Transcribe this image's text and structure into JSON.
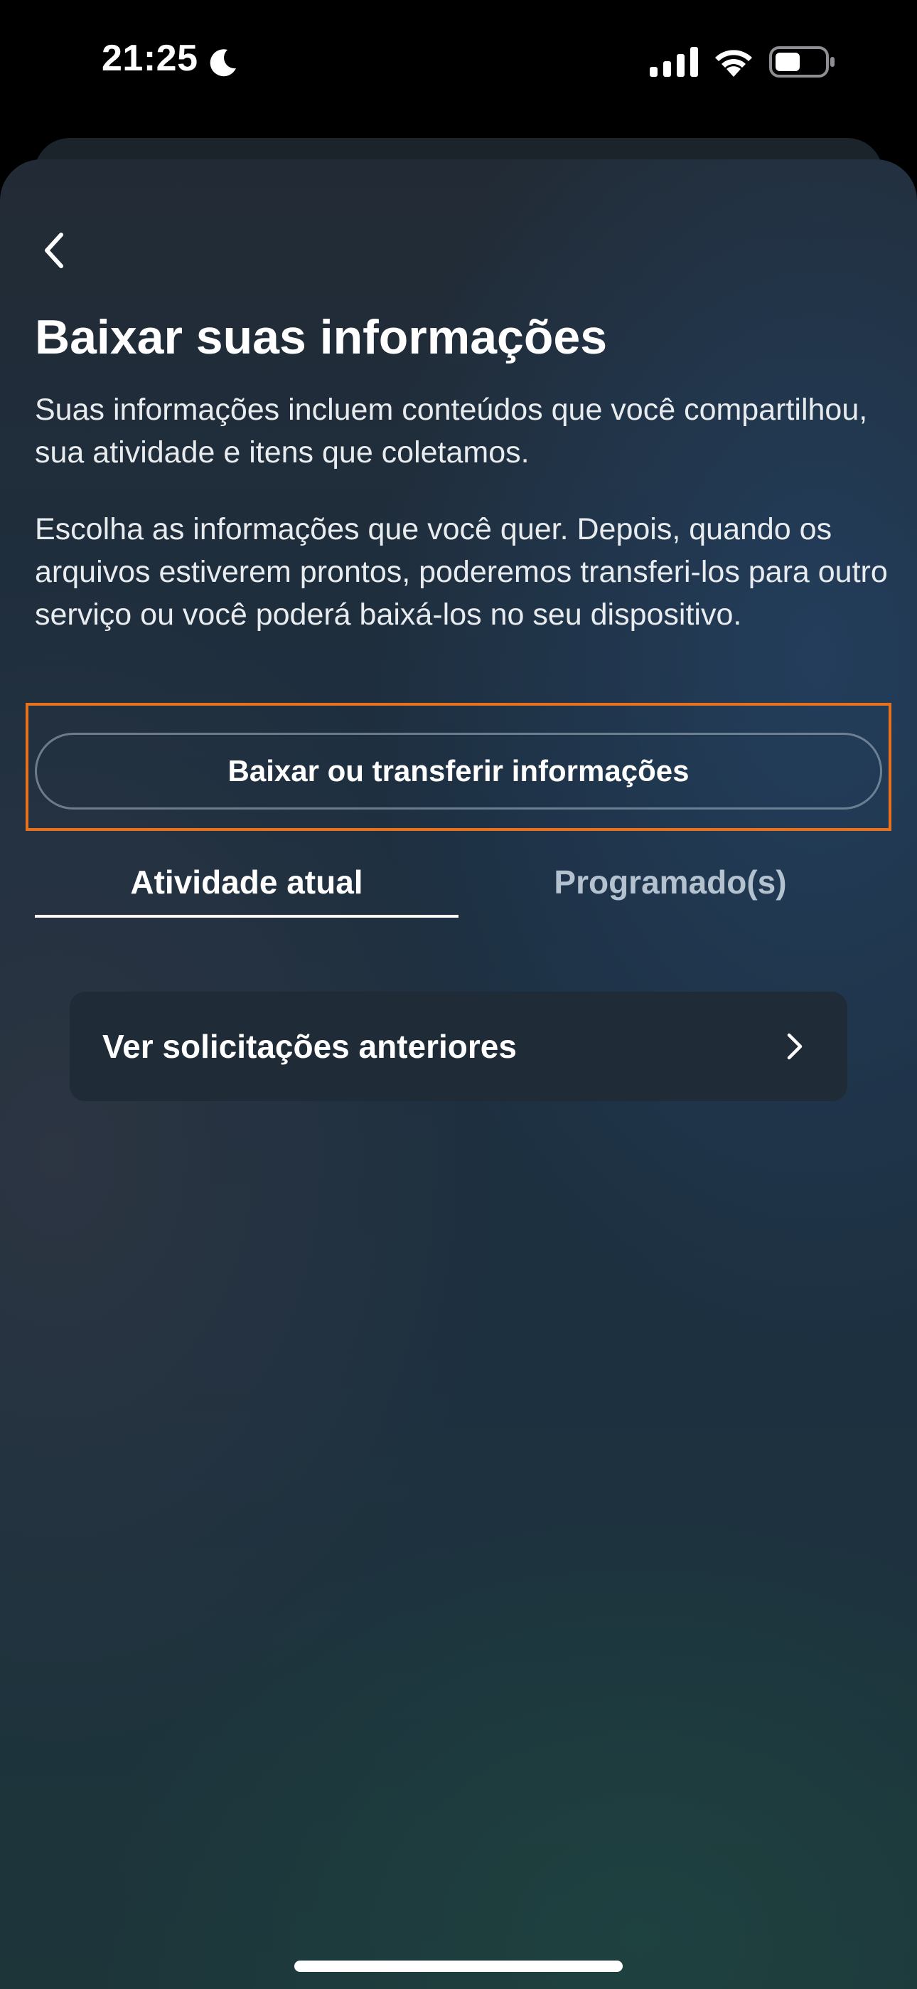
{
  "status_bar": {
    "time": "21:25",
    "icons": [
      "moon-icon",
      "signal-icon",
      "wifi-icon",
      "battery-icon"
    ]
  },
  "header": {
    "back_icon": "chevron-left-icon",
    "title": "Baixar suas informações"
  },
  "description": {
    "paragraph_1": "Suas informações incluem conteúdos que você compartilhou, sua atividade e itens que coletamos.",
    "paragraph_2": "Escolha as informações que você quer. Depois, quando os arquivos estiverem prontos, poderemos transferi-los para outro serviço ou você poderá baixá-los no seu dispositivo."
  },
  "primary_action": {
    "label": "Baixar ou transferir informações"
  },
  "tabs": [
    {
      "label": "Atividade atual",
      "active": true
    },
    {
      "label": "Programado(s)",
      "active": false
    }
  ],
  "list": {
    "items": [
      {
        "label": "Ver solicitações anteriores",
        "icon": "chevron-right-icon"
      }
    ]
  },
  "colors": {
    "highlight": "#e8711e",
    "text_primary": "#ffffff",
    "tab_inactive": "#b4c2cf",
    "card_background": "#1f2c38"
  }
}
